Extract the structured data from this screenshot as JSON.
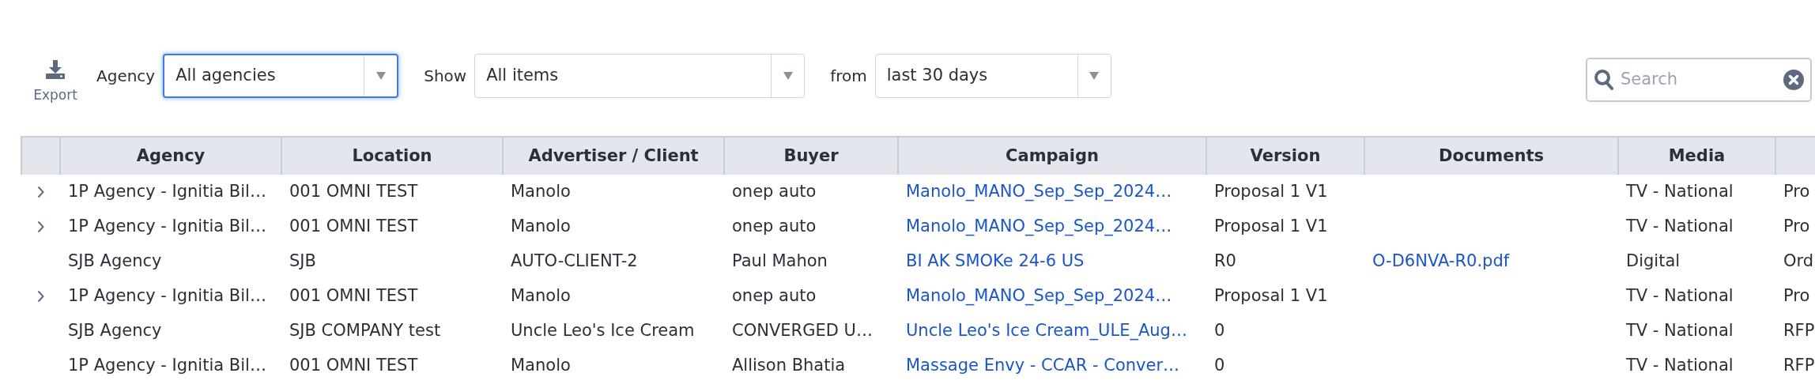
{
  "toolbar": {
    "export_label": "Export",
    "filters": [
      {
        "label": "Agency",
        "value": "All agencies",
        "focused": true
      },
      {
        "label": "Show",
        "value": "All items",
        "focused": false
      },
      {
        "label": "from",
        "value": "last 30 days",
        "focused": false
      }
    ],
    "search": {
      "placeholder": "Search"
    }
  },
  "table": {
    "columns": [
      "Agency",
      "Location",
      "Advertiser / Client",
      "Buyer",
      "Campaign",
      "Version",
      "Documents",
      "Media"
    ],
    "rows": [
      {
        "expandable": true,
        "agency": "1P Agency - Ignitia Bil…",
        "location": "001 OMNI TEST",
        "advertiser": "Manolo",
        "buyer": "onep auto",
        "campaign": "Manolo_MANO_Sep_Sep_2024…",
        "version": "Proposal 1 V1",
        "media": "TV - National",
        "column_10": "Pro"
      },
      {
        "expandable": true,
        "agency": "1P Agency - Ignitia Bil…",
        "location": "001 OMNI TEST",
        "advertiser": "Manolo",
        "buyer": "onep auto",
        "campaign": "Manolo_MANO_Sep_Sep_2024…",
        "version": "Proposal 1 V1",
        "media": "TV - National",
        "column_10": "Pro"
      },
      {
        "expandable": false,
        "agency": "SJB Agency",
        "location": "SJB",
        "advertiser": "AUTO-CLIENT-2",
        "buyer": "Paul Mahon",
        "campaign": "BI AK SMOKe 24-6 US",
        "version": "R0",
        "documents": "O-D6NVA-R0.pdf",
        "media": "Digital",
        "column_10": "Ord"
      },
      {
        "expandable": true,
        "agency": "1P Agency - Ignitia Bil…",
        "location": "001 OMNI TEST",
        "advertiser": "Manolo",
        "buyer": "onep auto",
        "campaign": "Manolo_MANO_Sep_Sep_2024…",
        "version": "Proposal 1 V1",
        "media": "TV - National",
        "column_10": "Pro"
      },
      {
        "expandable": false,
        "agency": "SJB Agency",
        "location": "SJB COMPANY test",
        "advertiser": "Uncle Leo's Ice Cream",
        "buyer": "CONVERGED U…",
        "campaign": "Uncle Leo's Ice Cream_ULE_Aug…",
        "version": "0",
        "media": "TV - National",
        "column_10": "RFP"
      },
      {
        "expandable": false,
        "agency": "1P Agency - Ignitia Bil…",
        "location": "001 OMNI TEST",
        "advertiser": "Manolo",
        "buyer": "Allison Bhatia",
        "campaign": "Massage Envy - CCAR - Conver…",
        "version": "0",
        "media": "TV - National",
        "column_10": "RFP"
      }
    ]
  }
}
